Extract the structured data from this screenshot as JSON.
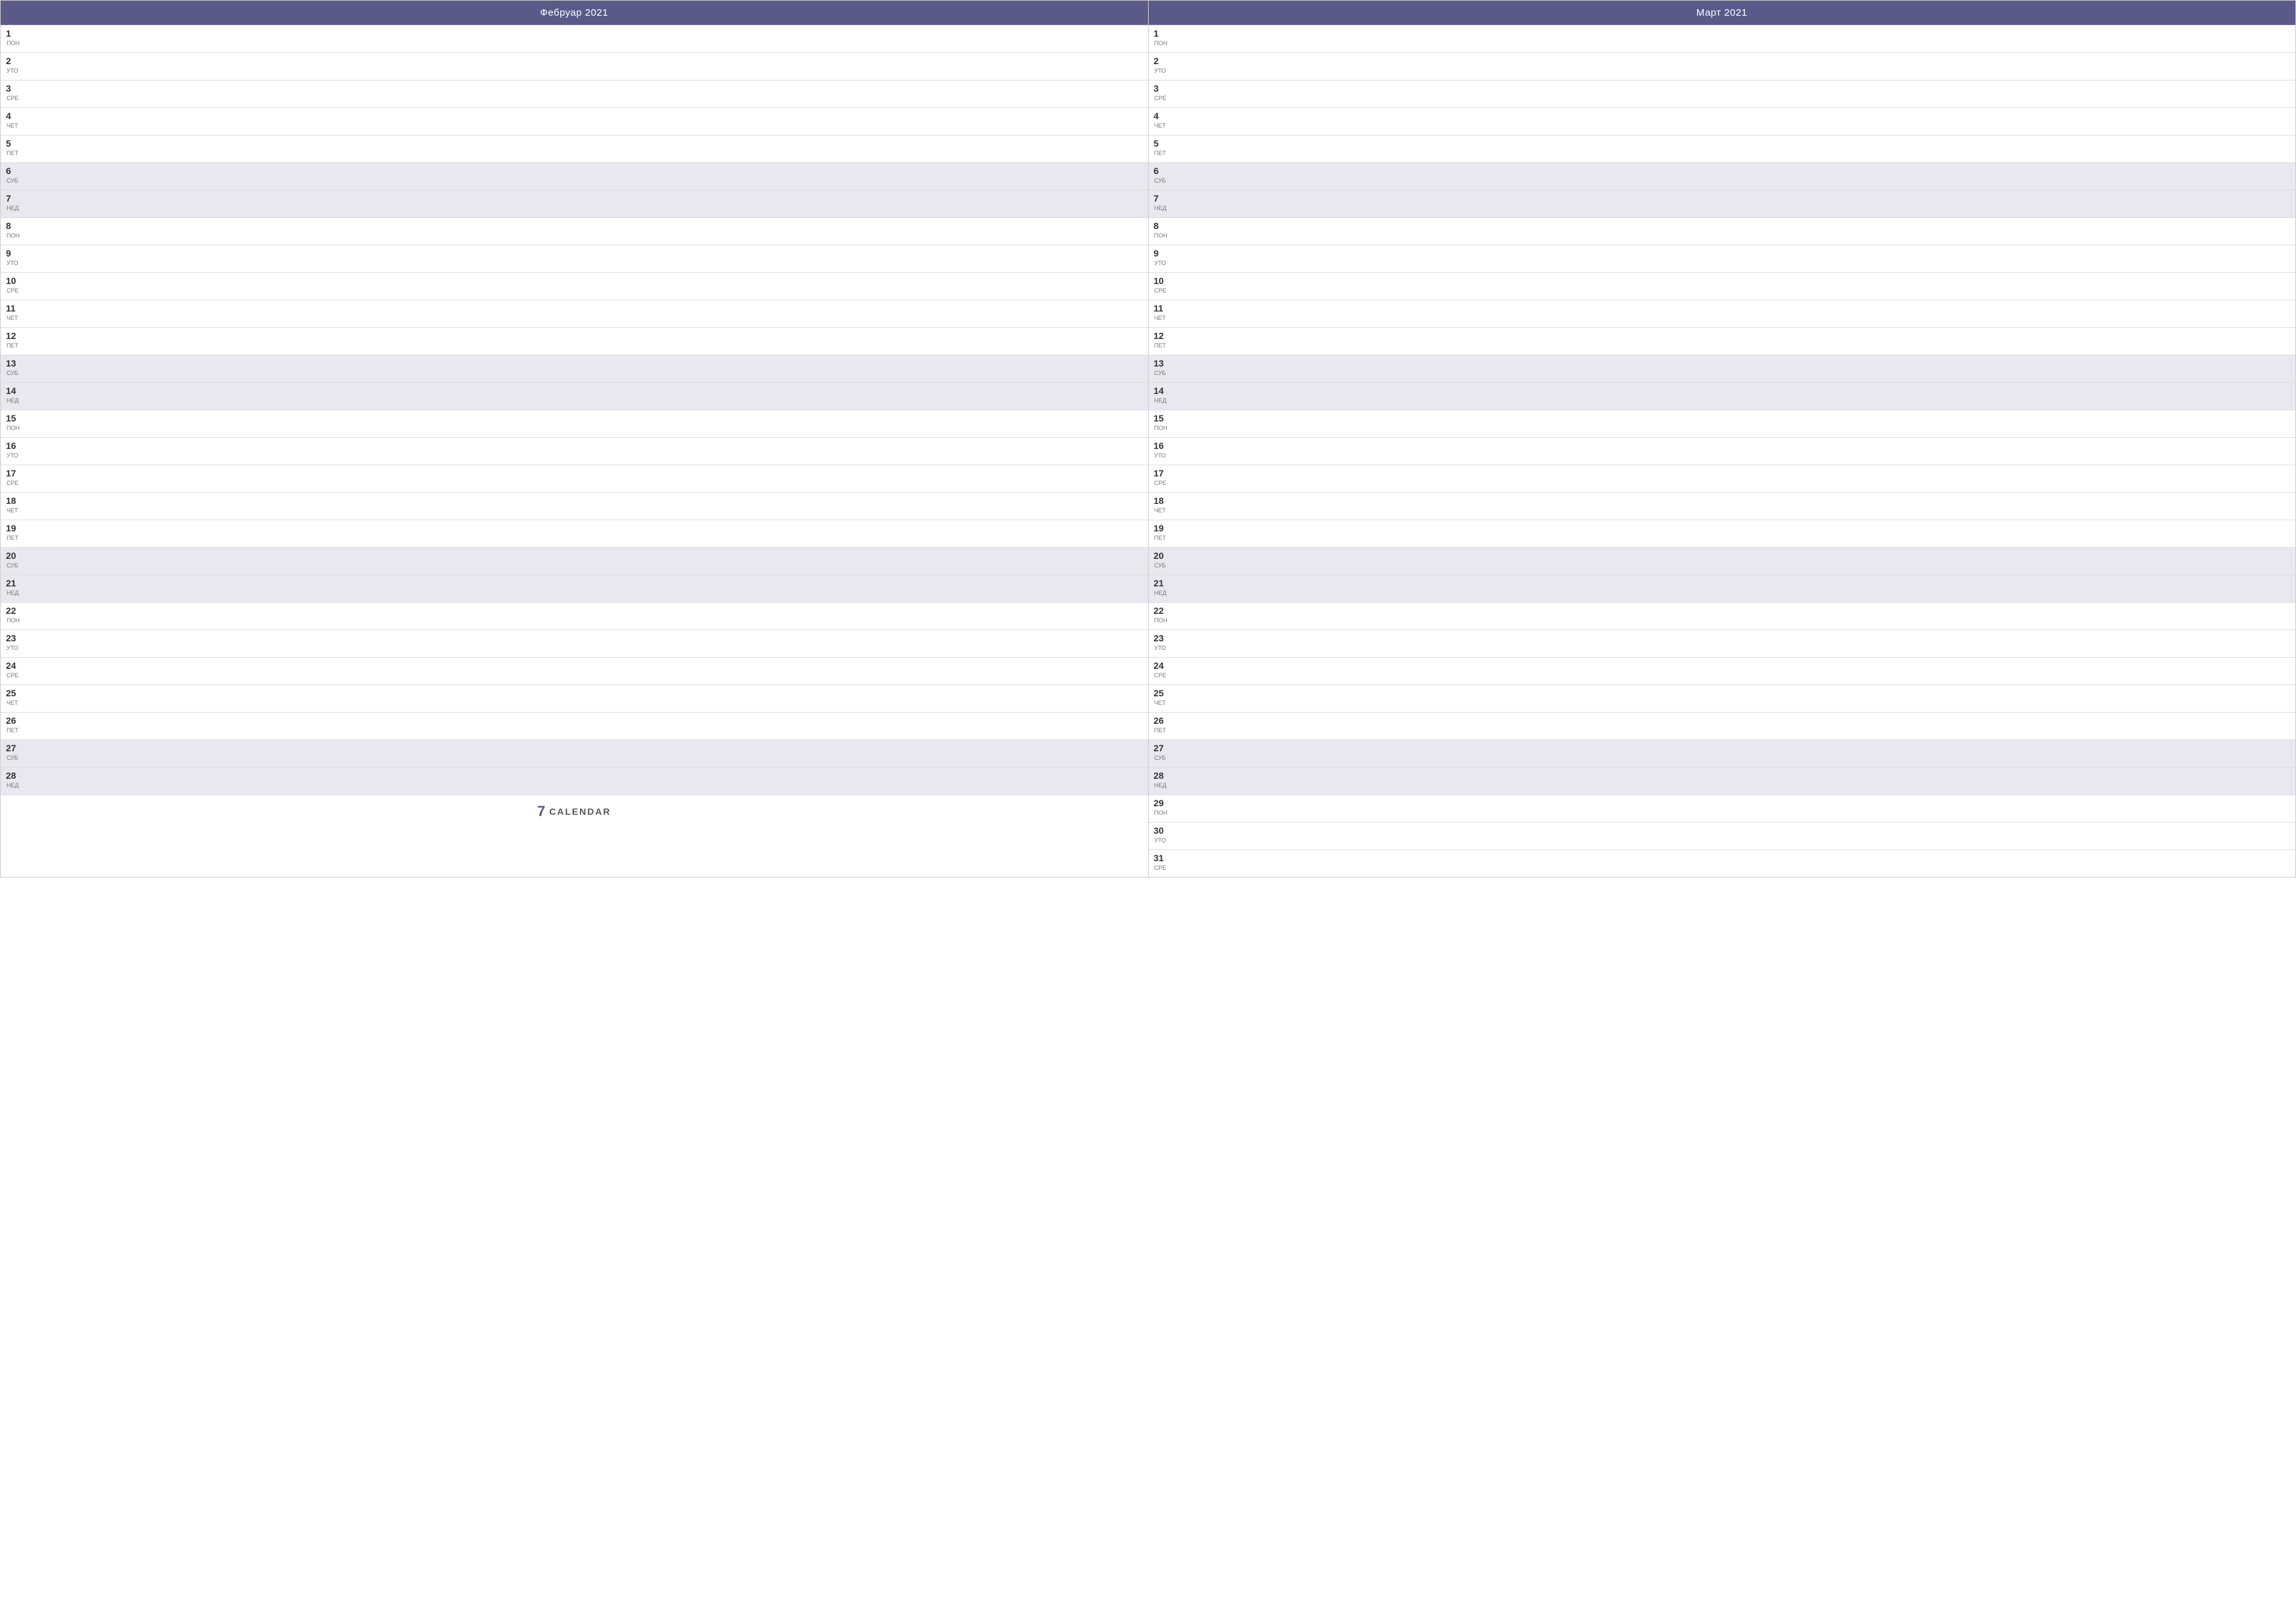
{
  "calendar": {
    "brand_icon": "7",
    "brand_label": "CALENDAR",
    "months": [
      {
        "id": "feb2021",
        "title": "Фебруар 2021",
        "days": [
          {
            "num": "1",
            "name": "ПОН",
            "weekend": false
          },
          {
            "num": "2",
            "name": "УТО",
            "weekend": false
          },
          {
            "num": "3",
            "name": "СРЕ",
            "weekend": false
          },
          {
            "num": "4",
            "name": "ЧЕТ",
            "weekend": false
          },
          {
            "num": "5",
            "name": "ПЕТ",
            "weekend": false
          },
          {
            "num": "6",
            "name": "СУБ",
            "weekend": true
          },
          {
            "num": "7",
            "name": "НЕД",
            "weekend": true
          },
          {
            "num": "8",
            "name": "ПОН",
            "weekend": false
          },
          {
            "num": "9",
            "name": "УТО",
            "weekend": false
          },
          {
            "num": "10",
            "name": "СРЕ",
            "weekend": false
          },
          {
            "num": "11",
            "name": "ЧЕТ",
            "weekend": false
          },
          {
            "num": "12",
            "name": "ПЕТ",
            "weekend": false
          },
          {
            "num": "13",
            "name": "СУБ",
            "weekend": true
          },
          {
            "num": "14",
            "name": "НЕД",
            "weekend": true
          },
          {
            "num": "15",
            "name": "ПОН",
            "weekend": false
          },
          {
            "num": "16",
            "name": "УТО",
            "weekend": false
          },
          {
            "num": "17",
            "name": "СРЕ",
            "weekend": false
          },
          {
            "num": "18",
            "name": "ЧЕТ",
            "weekend": false
          },
          {
            "num": "19",
            "name": "ПЕТ",
            "weekend": false
          },
          {
            "num": "20",
            "name": "СУБ",
            "weekend": true
          },
          {
            "num": "21",
            "name": "НЕД",
            "weekend": true
          },
          {
            "num": "22",
            "name": "ПОН",
            "weekend": false
          },
          {
            "num": "23",
            "name": "УТО",
            "weekend": false
          },
          {
            "num": "24",
            "name": "СРЕ",
            "weekend": false
          },
          {
            "num": "25",
            "name": "ЧЕТ",
            "weekend": false
          },
          {
            "num": "26",
            "name": "ПЕТ",
            "weekend": false
          },
          {
            "num": "27",
            "name": "СУБ",
            "weekend": true
          },
          {
            "num": "28",
            "name": "НЕД",
            "weekend": true
          }
        ],
        "has_brand": true
      },
      {
        "id": "mar2021",
        "title": "Март 2021",
        "days": [
          {
            "num": "1",
            "name": "ПОН",
            "weekend": false
          },
          {
            "num": "2",
            "name": "УТО",
            "weekend": false
          },
          {
            "num": "3",
            "name": "СРЕ",
            "weekend": false
          },
          {
            "num": "4",
            "name": "ЧЕТ",
            "weekend": false
          },
          {
            "num": "5",
            "name": "ПЕТ",
            "weekend": false
          },
          {
            "num": "6",
            "name": "СУБ",
            "weekend": true
          },
          {
            "num": "7",
            "name": "НЕД",
            "weekend": true
          },
          {
            "num": "8",
            "name": "ПОН",
            "weekend": false
          },
          {
            "num": "9",
            "name": "УТО",
            "weekend": false
          },
          {
            "num": "10",
            "name": "СРЕ",
            "weekend": false
          },
          {
            "num": "11",
            "name": "ЧЕТ",
            "weekend": false
          },
          {
            "num": "12",
            "name": "ПЕТ",
            "weekend": false
          },
          {
            "num": "13",
            "name": "СУБ",
            "weekend": true
          },
          {
            "num": "14",
            "name": "НЕД",
            "weekend": true
          },
          {
            "num": "15",
            "name": "ПОН",
            "weekend": false
          },
          {
            "num": "16",
            "name": "УТО",
            "weekend": false
          },
          {
            "num": "17",
            "name": "СРЕ",
            "weekend": false
          },
          {
            "num": "18",
            "name": "ЧЕТ",
            "weekend": false
          },
          {
            "num": "19",
            "name": "ПЕТ",
            "weekend": false
          },
          {
            "num": "20",
            "name": "СУБ",
            "weekend": true
          },
          {
            "num": "21",
            "name": "НЕД",
            "weekend": true
          },
          {
            "num": "22",
            "name": "ПОН",
            "weekend": false
          },
          {
            "num": "23",
            "name": "УТО",
            "weekend": false
          },
          {
            "num": "24",
            "name": "СРЕ",
            "weekend": false
          },
          {
            "num": "25",
            "name": "ЧЕТ",
            "weekend": false
          },
          {
            "num": "26",
            "name": "ПЕТ",
            "weekend": false
          },
          {
            "num": "27",
            "name": "СУБ",
            "weekend": true
          },
          {
            "num": "28",
            "name": "НЕД",
            "weekend": true
          },
          {
            "num": "29",
            "name": "ПОН",
            "weekend": false
          },
          {
            "num": "30",
            "name": "УТО",
            "weekend": false
          },
          {
            "num": "31",
            "name": "СРЕ",
            "weekend": false
          }
        ],
        "has_brand": false
      }
    ]
  }
}
